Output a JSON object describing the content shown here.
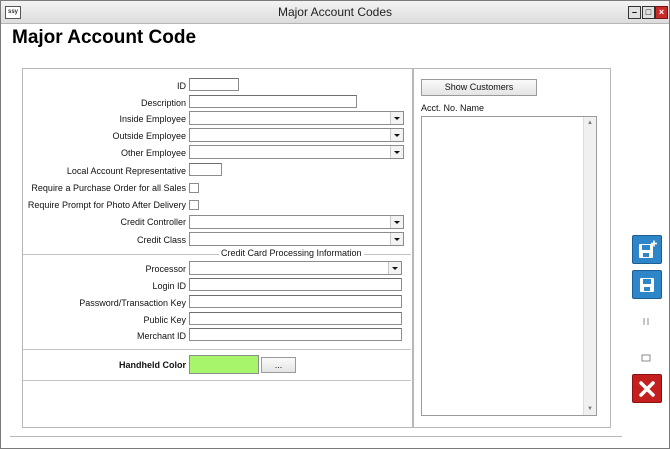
{
  "window": {
    "title": "Major Account Codes",
    "app_icon": "app-logo-icon"
  },
  "page_title": "Major Account Code",
  "fields": {
    "id": {
      "label": "ID",
      "value": ""
    },
    "description": {
      "label": "Description",
      "value": ""
    },
    "inside_employee": {
      "label": "Inside Employee",
      "value": ""
    },
    "outside_employee": {
      "label": "Outside Employee",
      "value": ""
    },
    "other_employee": {
      "label": "Other Employee",
      "value": ""
    },
    "local_rep": {
      "label": "Local Account Representative",
      "value": ""
    },
    "require_po": {
      "label": "Require a Purchase Order for all Sales",
      "checked": false
    },
    "require_photo": {
      "label": "Require Prompt for Photo After Delivery",
      "checked": false
    },
    "credit_controller": {
      "label": "Credit Controller",
      "value": ""
    },
    "credit_class": {
      "label": "Credit Class",
      "value": ""
    }
  },
  "cc_section": {
    "title": "Credit Card Processing Information",
    "processor": {
      "label": "Processor",
      "value": ""
    },
    "login_id": {
      "label": "Login ID",
      "value": ""
    },
    "password": {
      "label": "Password/Transaction Key",
      "value": ""
    },
    "public_key": {
      "label": "Public Key",
      "value": ""
    },
    "merchant_id": {
      "label": "Merchant ID",
      "value": ""
    }
  },
  "handheld": {
    "label": "Handheld Color",
    "color": "#a6f56a",
    "browse_label": "..."
  },
  "customers": {
    "show_button": "Show Customers",
    "columns": [
      "Acct. No.",
      "Name"
    ],
    "rows": []
  },
  "toolbar": [
    {
      "name": "search",
      "icon": "search-icon",
      "style": "gray"
    },
    {
      "name": "grid",
      "icon": "grid-icon",
      "style": "gray"
    },
    {
      "name": "up",
      "icon": "arrow-up-icon",
      "style": "gray"
    },
    {
      "name": "down",
      "icon": "arrow-down-icon",
      "style": "gray"
    },
    {
      "name": "edit",
      "icon": "pencil-icon",
      "style": "gray"
    },
    {
      "name": "add",
      "icon": "new-document-icon",
      "style": "gray"
    },
    {
      "name": "save-new",
      "icon": "save-new-icon",
      "style": "blue"
    },
    {
      "name": "save",
      "icon": "save-icon",
      "style": "blue"
    },
    {
      "name": "delete",
      "icon": "trash-icon",
      "style": "gray"
    },
    {
      "name": "print",
      "icon": "printer-icon",
      "style": "gray"
    },
    {
      "name": "cancel",
      "icon": "x-icon",
      "style": "red"
    },
    {
      "name": "exit",
      "icon": "exit-icon",
      "style": "gray"
    }
  ]
}
